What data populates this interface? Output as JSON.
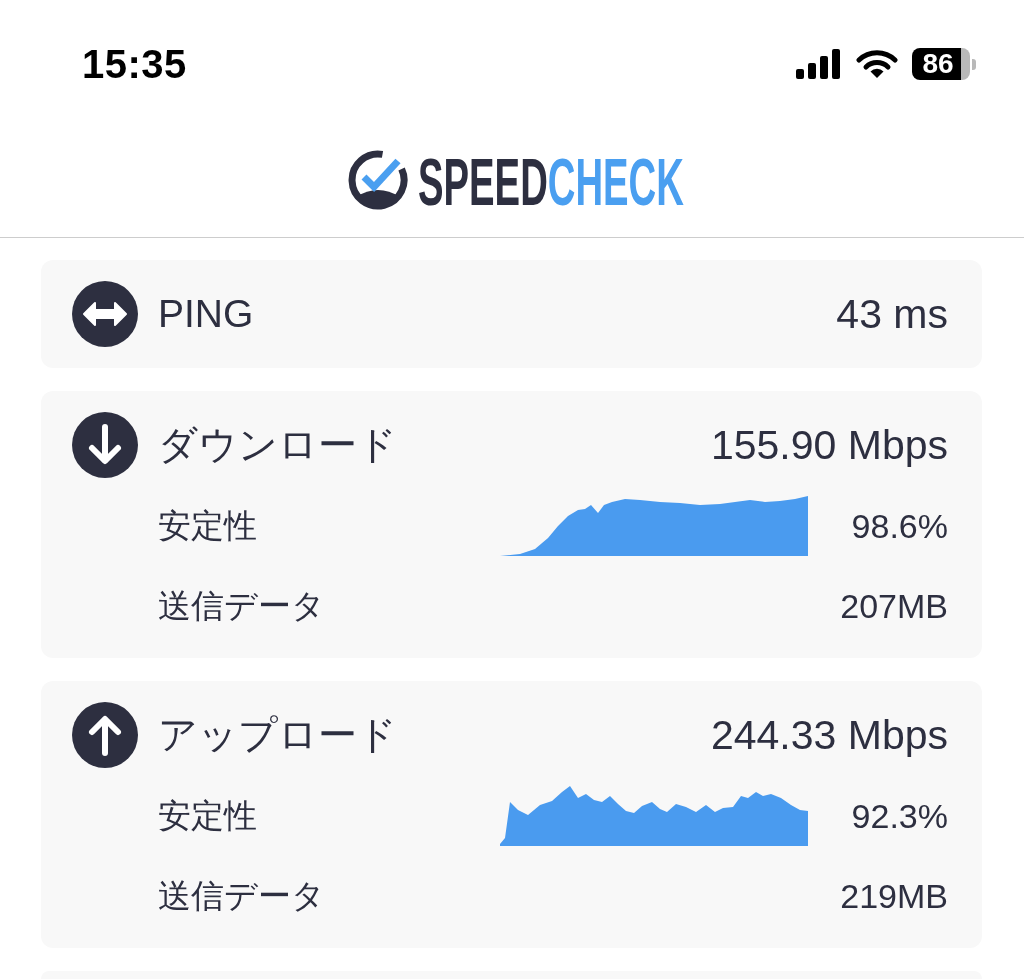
{
  "status_bar": {
    "time": "15:35",
    "battery": "86"
  },
  "header": {
    "logo": {
      "first": "SPEED",
      "second": "CHECK"
    }
  },
  "results": [
    {
      "kind": "ping",
      "label": "PING",
      "value": "43 ms"
    },
    {
      "kind": "download",
      "label": "ダウンロード",
      "value": "155.90 Mbps",
      "details": [
        {
          "kind": "stability",
          "label": "安定性",
          "value": "98.6%"
        },
        {
          "kind": "data",
          "label": "送信データ",
          "value": "207MB"
        }
      ]
    },
    {
      "kind": "upload",
      "label": "アップロード",
      "value": "244.33 Mbps",
      "details": [
        {
          "kind": "stability",
          "label": "安定性",
          "value": "92.3%"
        },
        {
          "kind": "data",
          "label": "送信データ",
          "value": "219MB"
        }
      ]
    }
  ]
}
